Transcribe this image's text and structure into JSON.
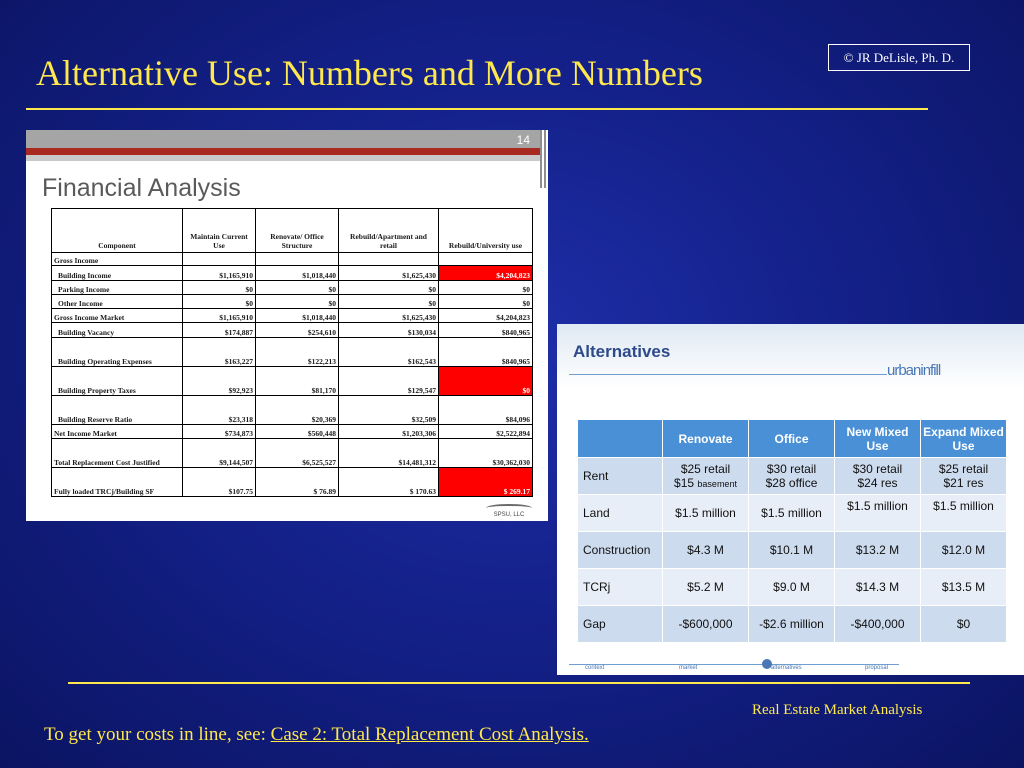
{
  "slide": {
    "title": "Alternative Use: Numbers and More Numbers",
    "copyright": "© JR DeLisle, Ph. D.",
    "footer_label": "Real Estate Market Analysis",
    "note_prefix": "To get your costs in line, see:",
    "note_link": "Case 2: Total Replacement Cost Analysis.",
    "colors": {
      "accent": "#ffe84d",
      "background": "#14218a"
    }
  },
  "left_slide": {
    "page_number": "14",
    "title": "Financial Analysis",
    "logo_text": "SPSU, LLC",
    "columns": [
      "Component",
      "Maintain Current Use",
      "Renovate/ Office Structure",
      "Rebuild/Apartment and retail",
      "Rebuild/University use"
    ],
    "rows": [
      {
        "label": "Gross Income",
        "values": [
          "",
          "",
          "",
          ""
        ]
      },
      {
        "label": "Building Income",
        "values": [
          "$1,165,910",
          "$1,018,440",
          "$1,625,430",
          "$4,204,823"
        ]
      },
      {
        "label": "Parking Income",
        "values": [
          "$0",
          "$0",
          "$0",
          "$0"
        ]
      },
      {
        "label": "Other Income",
        "values": [
          "$0",
          "$0",
          "$0",
          "$0"
        ]
      },
      {
        "label": "Gross Income Market",
        "values": [
          "$1,165,910",
          "$1,018,440",
          "$1,625,430",
          "$4,204,823"
        ]
      },
      {
        "label": "Building Vacancy",
        "values": [
          "$174,887",
          "$254,610",
          "$130,034",
          "$840,965"
        ]
      },
      {
        "label": "Building Operating Expenses",
        "values": [
          "$163,227",
          "$122,213",
          "$162,543",
          "$840,965"
        ]
      },
      {
        "label": "Building Property Taxes",
        "values": [
          "$92,923",
          "$81,170",
          "$129,547",
          "$0"
        ]
      },
      {
        "label": "Building Reserve Ratio",
        "values": [
          "$23,318",
          "$20,369",
          "$32,509",
          "$84,096"
        ]
      },
      {
        "label": "Net Income Market",
        "values": [
          "$734,873",
          "$560,448",
          "$1,203,306",
          "$2,522,894"
        ]
      },
      {
        "label": "Total Replacement Cost Justified",
        "values": [
          "$9,144,507",
          "$6,525,527",
          "$14,481,312",
          "$30,362,030"
        ]
      },
      {
        "label": "Fully loaded TRCj/Building SF",
        "values": [
          "$107.75",
          "$ 76.89",
          "$ 170.63",
          "$ 269.17"
        ]
      }
    ]
  },
  "right_slide": {
    "title": "Alternatives",
    "logo_text": "urbaninfill",
    "columns": [
      "",
      "Renovate",
      "Office",
      "New Mixed Use",
      "Expand Mixed Use"
    ],
    "rows": [
      {
        "label": "Rent",
        "values": [
          {
            "line1": "$25 retail",
            "line2": "$15",
            "line2_small": "basement"
          },
          {
            "line1": "$30 retail",
            "line2": "$28 office",
            "line2_small": ""
          },
          {
            "line1": "$30 retail",
            "line2": "$24 res",
            "line2_small": ""
          },
          {
            "line1": "$25 retail",
            "line2": "$21 res",
            "line2_small": ""
          }
        ]
      },
      {
        "label": "Land",
        "values": [
          "$1.5 million",
          "$1.5 million",
          "$1.5 million",
          "$1.5 million"
        ]
      },
      {
        "label": "Construction",
        "values": [
          "$4.3 M",
          "$10.1 M",
          "$13.2 M",
          "$12.0 M"
        ]
      },
      {
        "label": "TCRj",
        "values": [
          "$5.2 M",
          "$9.0 M",
          "$14.3 M",
          "$13.5 M"
        ]
      },
      {
        "label": "Gap",
        "values": [
          "-$600,000",
          "-$2.6 million",
          "-$400,000",
          "$0"
        ]
      }
    ],
    "nav": [
      "context",
      "market",
      "alternatives",
      "proposal"
    ]
  }
}
